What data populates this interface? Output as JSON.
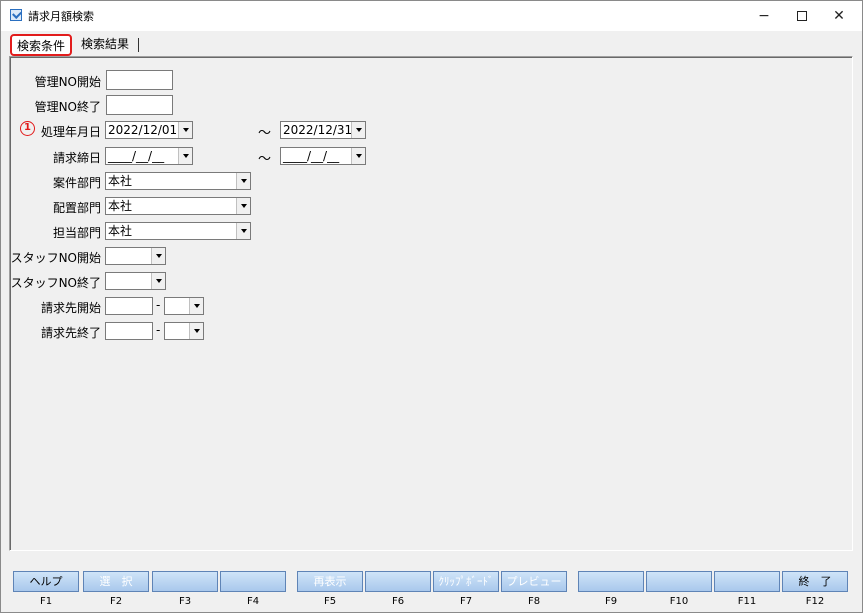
{
  "window": {
    "title": "請求月額検索",
    "minimize": "−",
    "close": "✕"
  },
  "tabs": [
    {
      "label": "検索条件",
      "active": true
    },
    {
      "label": "検索結果",
      "active": false
    }
  ],
  "form": {
    "kanri_no_start_label": "管理NO開始",
    "kanri_no_start_value": "",
    "kanri_no_end_label": "管理NO終了",
    "kanri_no_end_value": "",
    "marker": "1",
    "shori_label": "処理年月日",
    "shori_from": "2022/12/01",
    "shori_to": "2022/12/31",
    "tilde": "～",
    "shime_label": "請求締日",
    "shime_from": "____/__/__",
    "shime_to": "____/__/__",
    "anken_label": "案件部門",
    "anken_value": "本社",
    "haichi_label": "配置部門",
    "haichi_value": "本社",
    "tanto_label": "担当部門",
    "tanto_value": "本社",
    "staff_start_label": "スタッフNO開始",
    "staff_start_value": "",
    "staff_end_label": "スタッフNO終了",
    "staff_end_value": "",
    "seikyu_start_label": "請求先開始",
    "seikyu_end_label": "請求先終了",
    "dash": "-"
  },
  "fkeys": [
    {
      "key": "F1",
      "label": "ヘルプ",
      "enabled": true
    },
    {
      "key": "F2",
      "label": "選　択",
      "enabled": false
    },
    {
      "key": "F3",
      "label": "",
      "enabled": false
    },
    {
      "key": "F4",
      "label": "",
      "enabled": false
    },
    {
      "key": "F5",
      "label": "再表示",
      "enabled": false
    },
    {
      "key": "F6",
      "label": "",
      "enabled": false
    },
    {
      "key": "F7",
      "label": "ｸﾘｯﾌﾟﾎﾞｰﾄﾞ",
      "enabled": false
    },
    {
      "key": "F8",
      "label": "プレビュー",
      "enabled": false
    },
    {
      "key": "F9",
      "label": "",
      "enabled": false
    },
    {
      "key": "F10",
      "label": "",
      "enabled": false
    },
    {
      "key": "F11",
      "label": "",
      "enabled": false
    },
    {
      "key": "F12",
      "label": "終　了",
      "enabled": true
    }
  ]
}
